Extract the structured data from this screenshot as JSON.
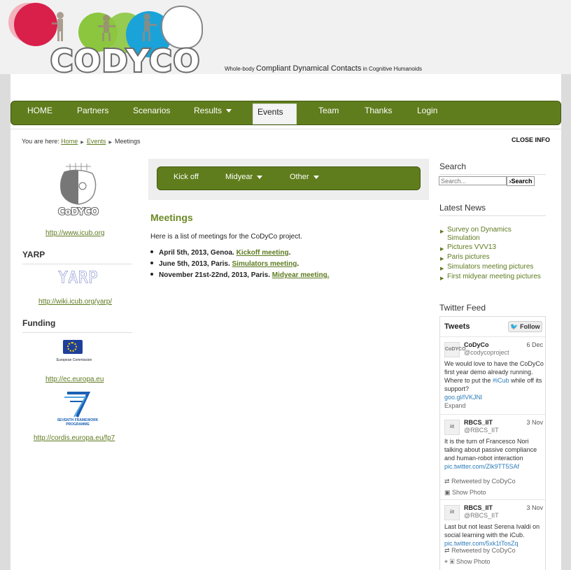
{
  "brand": {
    "logo_text": "CODYCO",
    "tagline_prefix": "Whole-body",
    "tagline_main": "Compliant Dynamical Contacts",
    "tagline_suffix": "in Cognitive Humanoids"
  },
  "nav": {
    "items": [
      {
        "label": "HOME"
      },
      {
        "label": "Partners"
      },
      {
        "label": "Scenarios"
      },
      {
        "label": "Results"
      },
      {
        "label": "Events"
      },
      {
        "label": "Team"
      },
      {
        "label": "Thanks"
      },
      {
        "label": "Login"
      }
    ],
    "active": "Events"
  },
  "breadcrumb": {
    "prefix": "You are here:",
    "items": [
      "Home",
      "Events",
      "Meetings"
    ]
  },
  "close_info": "CLOSE INFO",
  "left": {
    "icub_logo_text": "CoDYCO",
    "icub_link": "http://www.icub.org",
    "yarp_heading": "YARP",
    "yarp_logo_text": "YARP",
    "yarp_link": "http://wiki.icub.org/yarp/",
    "funding_heading": "Funding",
    "ec_logo_text": "European Commission",
    "ec_link": "http://ec.europa.eu",
    "fp7_logo_text": "SEVENTH FRAMEWORK PROGRAMME",
    "fp7_link": "http://cordis.europa.eu/fp7"
  },
  "main": {
    "subnav": [
      "Kick off",
      "Midyear",
      "Other"
    ],
    "title": "Meetings",
    "intro": "Here is a list of meetings for the CoDyCo project.",
    "meetings": [
      {
        "date": "April 5th, 2013, Genoa.",
        "link": "Kickoff meeting",
        "end": "."
      },
      {
        "date": "June 5th, 2013, Paris.",
        "link": "Simulators meeting",
        "end": "."
      },
      {
        "date": "November 21st-22nd, 2013, Paris.",
        "link": "Midyear meeting.",
        "end": ""
      }
    ]
  },
  "right": {
    "search_heading": "Search",
    "search_placeholder": "Search...",
    "search_button": "Search",
    "news_heading": "Latest News",
    "news": [
      "Survey on Dynamics Simulation",
      "Pictures VVV13",
      "Paris pictures",
      "Simulators meeting pictures",
      "First midyear meeting pictures"
    ],
    "twitter_heading": "Twitter Feed"
  },
  "twitter": {
    "title": "Tweets",
    "follow": "Follow",
    "tweets": [
      {
        "avatar": "CoDYCO",
        "name": "CoDyCo",
        "handle": "@codycoproject",
        "date": "6 Dec",
        "text": "We would love to have the CoDyCo first year demo already running. Where to put the ",
        "hashtag": "#iCub",
        "text2": " while off its support?",
        "link": "goo.gl/lVKJNl",
        "meta1": "Expand"
      },
      {
        "avatar": "iit",
        "name": "RBCS_IIT",
        "handle": "@RBCS_IIT",
        "date": "3 Nov",
        "text": "It is the turn of Francesco Nori talking about passive compliance and human-robot interaction",
        "link": "pic.twitter.com/Zlk9TT5SAf",
        "meta1": "Retweeted by CoDyCo",
        "meta2": "Show Photo"
      },
      {
        "avatar": "iit",
        "name": "RBCS_IIT",
        "handle": "@RBCS_IIT",
        "date": "3 Nov",
        "text": "Last but not least Serena Ivaldi on social learning with the iCub.",
        "link": "pic.twitter.com/5xk1tTosZq",
        "meta1": "Retweeted by CoDyCo",
        "meta2": "Show Photo"
      }
    ]
  },
  "colors": {
    "nav_green": "#5f7d1c",
    "link_green": "#5d7a1f",
    "circle_red": "#d9204a",
    "circle_green": "#8cc63f",
    "circle_blue": "#1aa3d9",
    "twitter_blue": "#2aa3ef"
  }
}
